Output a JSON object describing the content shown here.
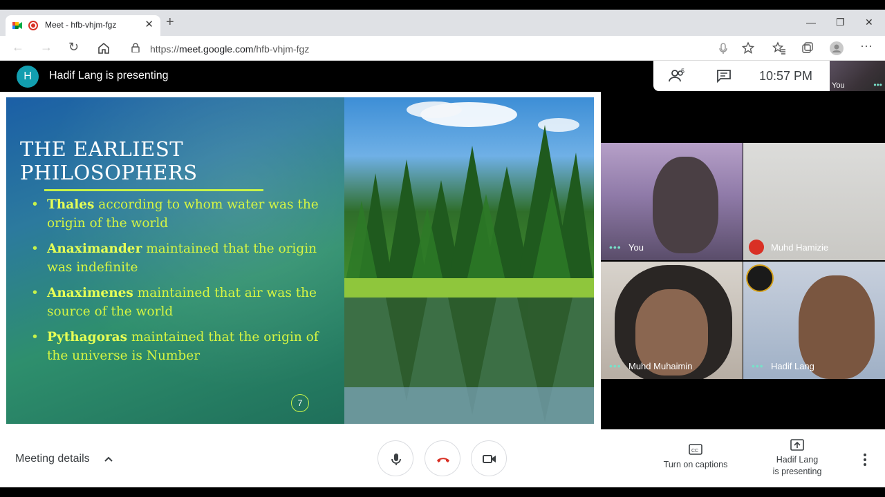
{
  "browser": {
    "tab_title": "Meet - hfb-vhjm-fgz",
    "url_prefix": "https://",
    "url_host": "meet.google.com",
    "url_path": "/hfb-vhjm-fgz"
  },
  "meet": {
    "presenter_initial": "H",
    "presenting_label": "Hadif Lang is presenting",
    "people_count": "5",
    "time": "10:57 PM",
    "self_view_label": "You"
  },
  "slide": {
    "title": "THE EARLIEST PHILOSOPHERS",
    "bullets": [
      {
        "name": "Thales",
        "text": " according to whom water was the origin of the world"
      },
      {
        "name": "Anaximander",
        "text": " maintained that the origin was indefinite"
      },
      {
        "name": "Anaximenes",
        "text": " maintained that air was the source of the world"
      },
      {
        "name": "Pythagoras",
        "text": " maintained that the origin of the universe is Number"
      }
    ],
    "page_number": "7"
  },
  "participants": [
    {
      "name": "You",
      "muted": false
    },
    {
      "name": "Muhd Hamizie",
      "muted": true
    },
    {
      "name": "Muhd Muhaimin",
      "muted": false
    },
    {
      "name": "Hadif Lang",
      "muted": false
    }
  ],
  "bottom": {
    "meeting_details": "Meeting details",
    "captions_label": "Turn on captions",
    "presenting_line1": "Hadif Lang",
    "presenting_line2": "is presenting"
  },
  "colors": {
    "accent_teal": "#129eaf",
    "end_call_red": "#d93025",
    "slide_bullet": "#d6f542"
  }
}
